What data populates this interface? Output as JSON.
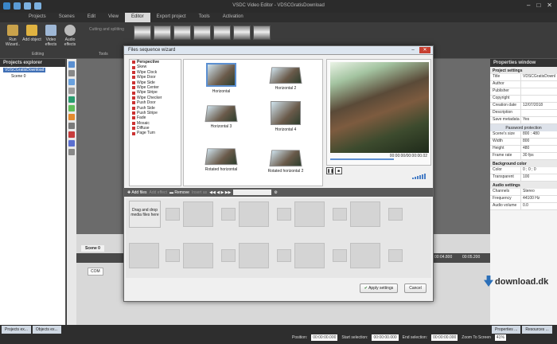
{
  "window_title": "VSDC Video Editor - VDSCGratisDownload",
  "menu": [
    "Projects",
    "Scenes",
    "Edit",
    "View",
    "Editor",
    "Export project",
    "Tools",
    "Activation"
  ],
  "menu_active_index": 4,
  "ribbon": {
    "buttons": [
      {
        "label": "Run Wizard..",
        "icon": "wand-icon"
      },
      {
        "label": "Add object",
        "icon": "add-object-icon"
      },
      {
        "label": "Video effects",
        "icon": "video-effects-icon"
      },
      {
        "label": "Audio effects",
        "icon": "headphones-icon"
      }
    ],
    "group_editing": "Editing",
    "group_tools": "Tools",
    "cutting": "Cutting and splitting"
  },
  "left_panel": {
    "title": "Projects explorer",
    "project": "VDSCGratisDownload",
    "scene": "Scene 0"
  },
  "dialog": {
    "title": "Files sequence wizard",
    "categories": [
      "Perspective",
      "Skew",
      "Wipe Clock",
      "Wipe Door",
      "Wipe Side",
      "Wipe Center",
      "Wipe Stripe",
      "Wipe Checker",
      "Push Door",
      "Push Side",
      "Push Stripe",
      "Fade",
      "Mosaic",
      "Diffuse",
      "Page Turn"
    ],
    "thumbs": [
      "Horizontal",
      "Horizontal 2",
      "Horizontal 3",
      "Horizontal 4",
      "Rotated horizontal",
      "Rotated horizontal 2",
      "Rotated horizontal 3",
      "Rotated horizontal 4"
    ],
    "time": "00:00:00/00:00:00.02",
    "toolbar": {
      "add": "Add files",
      "add_effect": "Add effect",
      "remove": "Remove",
      "insert": "Insert as"
    },
    "dropzone": "Drag and drop media files here",
    "apply": "Apply settings",
    "cancel": "Cancel"
  },
  "right_panel": {
    "title": "Properties window",
    "section_project": "Project settings",
    "rows": [
      {
        "k": "Title",
        "v": "VDSCGratisDownl"
      },
      {
        "k": "Author",
        "v": ""
      },
      {
        "k": "Publisher",
        "v": ""
      },
      {
        "k": "Copyright",
        "v": ""
      },
      {
        "k": "Creation date",
        "v": "12/07/2018"
      },
      {
        "k": "Description",
        "v": ""
      },
      {
        "k": "Save metadata",
        "v": "Yes"
      }
    ],
    "password": "Password protection",
    "rows2": [
      {
        "k": "Scene's size",
        "v": "800 : 480"
      },
      {
        "k": "Width",
        "v": "800"
      },
      {
        "k": "Height",
        "v": "480"
      },
      {
        "k": "Frame rate",
        "v": "30 fps"
      }
    ],
    "section_bg": "Background color",
    "rows3": [
      {
        "k": "Color",
        "v": "0 ; 0 ; 0"
      },
      {
        "k": "Transparent",
        "v": "100"
      }
    ],
    "section_audio": "Audio settings",
    "rows4": [
      {
        "k": "Channels",
        "v": "Stereo"
      },
      {
        "k": "Frequency",
        "v": "44100 Hz"
      },
      {
        "k": "Audio volume",
        "v": "0.0"
      }
    ]
  },
  "timeline": {
    "scene_tab": "Scene 0",
    "com": "COM",
    "t1": "00:04.800",
    "t2": "00:05.200"
  },
  "watermark": "download.dk",
  "status": {
    "tabs": [
      "Projects ex...",
      "Objects ex..."
    ],
    "right_tabs": [
      "Properties ...",
      "Resources ..."
    ],
    "position_label": "Position:",
    "position": "00:00:00.000",
    "start_label": "Start selection:",
    "start": "00:00:00.000",
    "end_label": "End selection:",
    "end": "00:00:00.000",
    "zoom": "Zoom To Screen",
    "zoom_val": "41%"
  }
}
